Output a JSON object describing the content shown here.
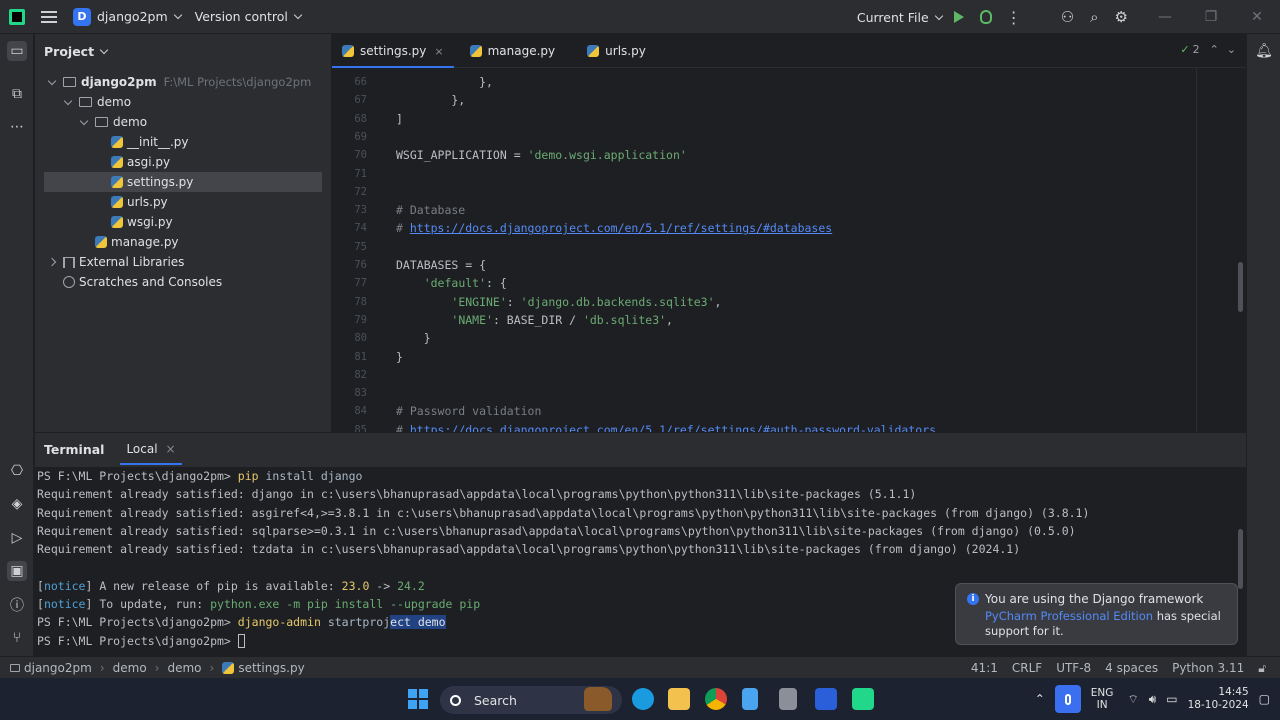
{
  "titlebar": {
    "project_badge": "D",
    "project_name": "django2pm",
    "vcs": "Version control",
    "run_config": "Current File"
  },
  "project_panel": {
    "title": "Project",
    "tree": [
      {
        "label": "django2pm",
        "sub": "F:\\ML Projects\\django2pm",
        "type": "folder",
        "expanded": true
      },
      {
        "label": "demo",
        "type": "folder",
        "expanded": true
      },
      {
        "label": "demo",
        "type": "package",
        "expanded": true
      },
      {
        "label": "__init__.py",
        "type": "py"
      },
      {
        "label": "asgi.py",
        "type": "py"
      },
      {
        "label": "settings.py",
        "type": "py",
        "selected": true
      },
      {
        "label": "urls.py",
        "type": "py"
      },
      {
        "label": "wsgi.py",
        "type": "py"
      },
      {
        "label": "manage.py",
        "type": "py"
      },
      {
        "label": "External Libraries",
        "type": "lib"
      },
      {
        "label": "Scratches and Consoles",
        "type": "scratch"
      }
    ]
  },
  "editor": {
    "tabs": [
      {
        "label": "settings.py",
        "close": "×",
        "active": true
      },
      {
        "label": "manage.py"
      },
      {
        "label": "urls.py"
      }
    ],
    "inspections": "2",
    "lines": [
      {
        "n": "66",
        "parts": [
          {
            "t": "            },",
            "c": ""
          }
        ]
      },
      {
        "n": "67",
        "parts": [
          {
            "t": "        },",
            "c": ""
          }
        ]
      },
      {
        "n": "68",
        "parts": [
          {
            "t": "]",
            "c": ""
          }
        ]
      },
      {
        "n": "69",
        "parts": []
      },
      {
        "n": "70",
        "parts": [
          {
            "t": "WSGI_APPLICATION = ",
            "c": ""
          },
          {
            "t": "'demo.wsgi.application'",
            "c": "c-str"
          }
        ]
      },
      {
        "n": "71",
        "parts": []
      },
      {
        "n": "72",
        "parts": []
      },
      {
        "n": "73",
        "parts": [
          {
            "t": "# Database",
            "c": "c-com"
          }
        ]
      },
      {
        "n": "74",
        "parts": [
          {
            "t": "# ",
            "c": "c-com"
          },
          {
            "t": "https://docs.djangoproject.com/en/5.1/ref/settings/#databases",
            "c": "c-link"
          }
        ]
      },
      {
        "n": "75",
        "parts": []
      },
      {
        "n": "76",
        "parts": [
          {
            "t": "DATABASES = {",
            "c": ""
          }
        ]
      },
      {
        "n": "77",
        "parts": [
          {
            "t": "    ",
            "c": ""
          },
          {
            "t": "'default'",
            "c": "c-str"
          },
          {
            "t": ": {",
            "c": ""
          }
        ]
      },
      {
        "n": "78",
        "parts": [
          {
            "t": "        ",
            "c": ""
          },
          {
            "t": "'ENGINE'",
            "c": "c-str"
          },
          {
            "t": ": ",
            "c": ""
          },
          {
            "t": "'django.db.backends.sqlite3'",
            "c": "c-str"
          },
          {
            "t": ",",
            "c": ""
          }
        ]
      },
      {
        "n": "79",
        "parts": [
          {
            "t": "        ",
            "c": ""
          },
          {
            "t": "'NAME'",
            "c": "c-str"
          },
          {
            "t": ": BASE_DIR / ",
            "c": ""
          },
          {
            "t": "'db.sqlite3'",
            "c": "c-str"
          },
          {
            "t": ",",
            "c": ""
          }
        ]
      },
      {
        "n": "80",
        "parts": [
          {
            "t": "    }",
            "c": ""
          }
        ]
      },
      {
        "n": "81",
        "parts": [
          {
            "t": "}",
            "c": ""
          }
        ]
      },
      {
        "n": "82",
        "parts": []
      },
      {
        "n": "83",
        "parts": []
      },
      {
        "n": "84",
        "parts": [
          {
            "t": "# Password validation",
            "c": "c-com"
          }
        ]
      },
      {
        "n": "85",
        "parts": [
          {
            "t": "# ",
            "c": "c-com"
          },
          {
            "t": "https://docs.djangoproject.com/en/5.1/ref/settings/#auth-password-validators",
            "c": "c-link"
          }
        ]
      }
    ]
  },
  "terminal": {
    "title": "Terminal",
    "tab": "Local",
    "tab_close": "×",
    "lines": [
      {
        "parts": [
          {
            "t": "PS F:\\ML Projects\\django2pm> ",
            "c": ""
          },
          {
            "t": "pip",
            "c": "t-cmd"
          },
          {
            "t": " install django",
            "c": "t-arg"
          }
        ]
      },
      {
        "parts": [
          {
            "t": "Requirement already satisfied: django in c:\\users\\bhanuprasad\\appdata\\local\\programs\\python\\python311\\lib\\site-packages (5.1.1)",
            "c": ""
          }
        ]
      },
      {
        "parts": [
          {
            "t": "Requirement already satisfied: asgiref<4,>=3.8.1 in c:\\users\\bhanuprasad\\appdata\\local\\programs\\python\\python311\\lib\\site-packages (from django) (3.8.1)",
            "c": ""
          }
        ]
      },
      {
        "parts": [
          {
            "t": "Requirement already satisfied: sqlparse>=0.3.1 in c:\\users\\bhanuprasad\\appdata\\local\\programs\\python\\python311\\lib\\site-packages (from django) (0.5.0)",
            "c": ""
          }
        ]
      },
      {
        "parts": [
          {
            "t": "Requirement already satisfied: tzdata in c:\\users\\bhanuprasad\\appdata\\local\\programs\\python\\python311\\lib\\site-packages (from django) (2024.1)",
            "c": ""
          }
        ]
      },
      {
        "parts": []
      },
      {
        "parts": [
          {
            "t": "[",
            "c": ""
          },
          {
            "t": "notice",
            "c": "t-notice"
          },
          {
            "t": "] A new release of pip is available: ",
            "c": ""
          },
          {
            "t": "23.0",
            "c": "t-ver1"
          },
          {
            "t": " -> ",
            "c": ""
          },
          {
            "t": "24.2",
            "c": "t-ver2"
          }
        ]
      },
      {
        "parts": [
          {
            "t": "[",
            "c": ""
          },
          {
            "t": "notice",
            "c": "t-notice"
          },
          {
            "t": "] To update, run: ",
            "c": ""
          },
          {
            "t": "python.exe -m pip install --upgrade pip",
            "c": "t-ver2"
          }
        ]
      },
      {
        "parts": [
          {
            "t": "PS F:\\ML Projects\\django2pm> ",
            "c": ""
          },
          {
            "t": "django-admin",
            "c": "t-cmd"
          },
          {
            "t": " startproj",
            "c": "t-arg"
          },
          {
            "t": "ect demo",
            "c": "t-sel"
          }
        ]
      },
      {
        "parts": [
          {
            "t": "PS F:\\ML Projects\\django2pm> ",
            "c": ""
          }
        ],
        "cursor": true
      }
    ]
  },
  "notification": {
    "icon": "i",
    "title": "You are using the Django framework",
    "link": "PyCharm Professional Edition",
    "rest": " has special support for it."
  },
  "statusbar": {
    "breadcrumb": [
      "django2pm",
      "demo",
      "demo",
      "settings.py"
    ],
    "position": "41:1",
    "line_sep": "CRLF",
    "encoding": "UTF-8",
    "indent": "4 spaces",
    "interpreter": "Python 3.11"
  },
  "taskbar": {
    "search": "Search",
    "lang_line1": "ENG",
    "lang_line2": "IN",
    "time": "14:45",
    "date": "18-10-2024"
  }
}
